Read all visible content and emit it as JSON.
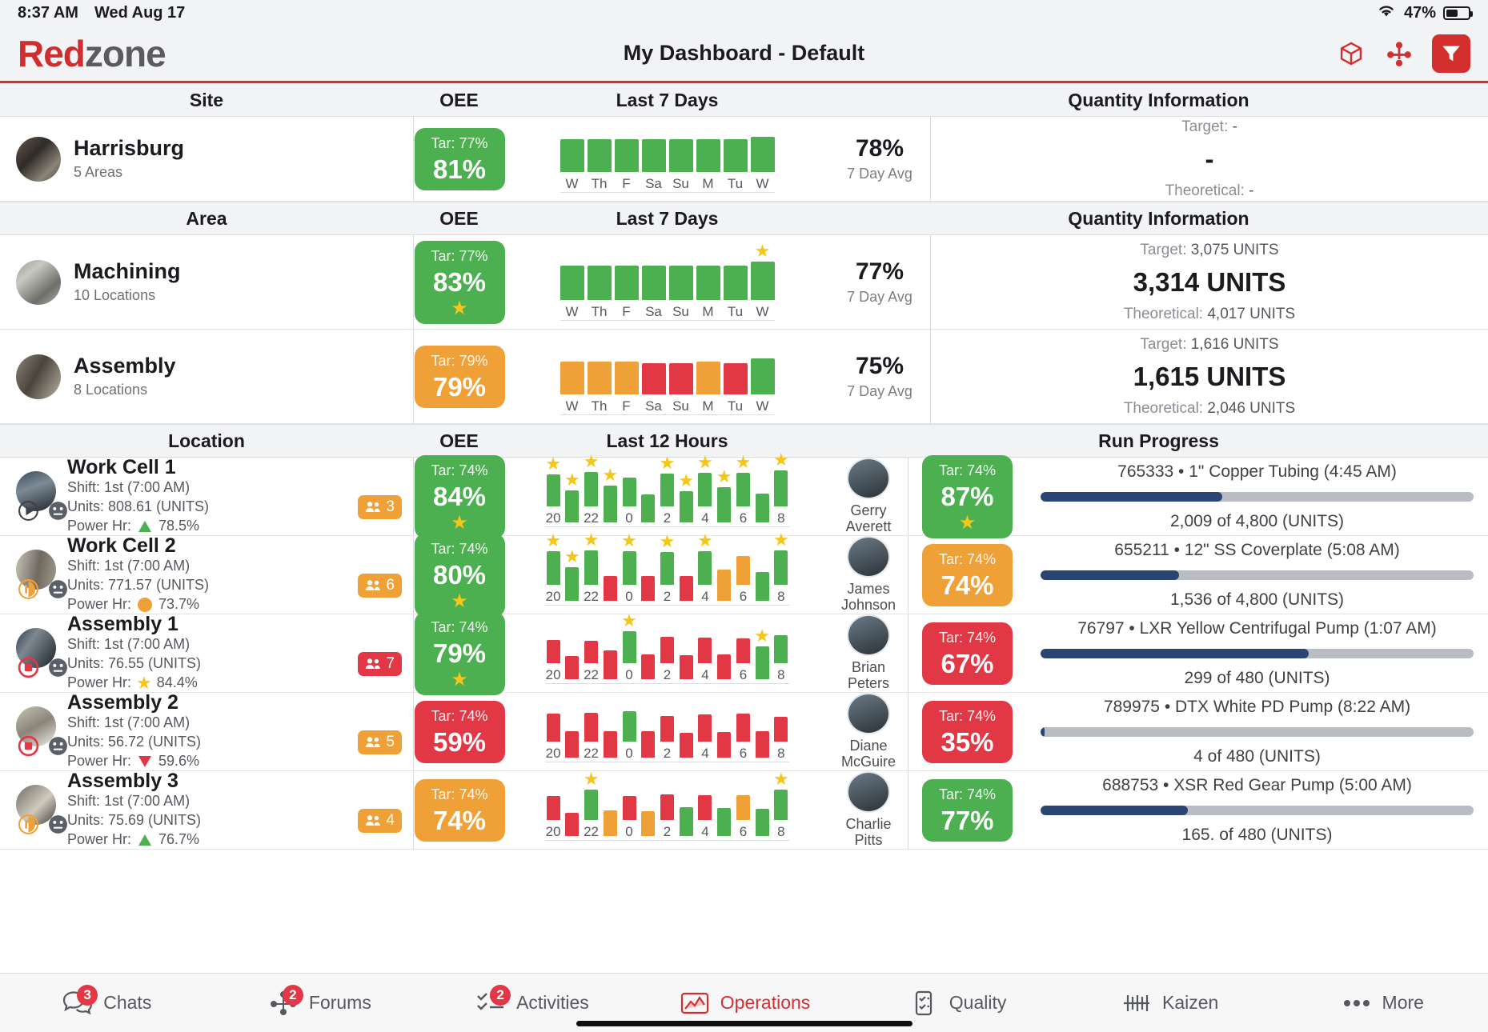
{
  "status_bar": {
    "time": "8:37 AM",
    "date": "Wed Aug 17",
    "battery_pct": "47%",
    "wifi_icon": "wifi-icon",
    "battery_icon": "battery-icon"
  },
  "header": {
    "logo_left": "Red",
    "logo_right": "zone",
    "title": "My Dashboard - Default",
    "icons": [
      {
        "name": "package-icon",
        "label": "Package"
      },
      {
        "name": "network-icon",
        "label": "Network"
      },
      {
        "name": "filter-icon",
        "label": "Filter"
      }
    ],
    "accent_color": "#d32f2f"
  },
  "sections": {
    "site": {
      "col_name": "Site",
      "col_oee": "OEE",
      "col_chart": "Last 7 Days",
      "col_qty": "Quantity Information"
    },
    "area": {
      "col_name": "Area",
      "col_oee": "OEE",
      "col_chart": "Last 7 Days",
      "col_qty": "Quantity Information"
    },
    "location": {
      "col_name": "Location",
      "col_oee": "OEE",
      "col_chart": "Last 12 Hours",
      "col_qty": "Run Progress"
    }
  },
  "labels": {
    "avg_label": "7 Day Avg",
    "target": "Target:",
    "theoretical": "Theoretical:",
    "tar_prefix": "Tar: "
  },
  "site_rows": [
    {
      "name": "Harrisburg",
      "sub": "5 Areas",
      "oee": {
        "target": "Tar: 77%",
        "value": "81%",
        "color": "g",
        "star": false
      },
      "avg": "78%",
      "qty": {
        "target": "-",
        "value": "-",
        "theoretical": "-"
      }
    }
  ],
  "area_rows": [
    {
      "name": "Machining",
      "sub": "10 Locations",
      "oee": {
        "target": "Tar: 77%",
        "value": "83%",
        "color": "g",
        "star": true
      },
      "avg": "77%",
      "qty": {
        "target": "3,075 UNITS",
        "value": "3,314 UNITS",
        "theoretical": "4,017 UNITS"
      }
    },
    {
      "name": "Assembly",
      "sub": "8 Locations",
      "oee": {
        "target": "Tar: 79%",
        "value": "79%",
        "color": "o",
        "star": false
      },
      "avg": "75%",
      "qty": {
        "target": "1,616 UNITS",
        "value": "1,615 UNITS",
        "theoretical": "2,046 UNITS"
      }
    }
  ],
  "location_rows": [
    {
      "name": "Work Cell 1",
      "shift": "Shift: 1st (7:00 AM)",
      "units": "Units: 808.61 (UNITS)",
      "power_hr": "Power Hr:",
      "power_val": "78.5%",
      "power_icon": "up-triangle-icon",
      "run_icon": "play-icon",
      "mood_icon": "neutral-face-icon",
      "people": "3",
      "people_color": "o",
      "oee": {
        "target": "Tar: 74%",
        "value": "84%",
        "color": "g",
        "star": true
      },
      "person": "Gerry\nAverett",
      "oee2": {
        "target": "Tar: 74%",
        "value": "87%",
        "color": "g",
        "star": true
      },
      "run": {
        "title": "765333 • 1\" Copper Tubing (4:45 AM)",
        "sub": "2,009 of 4,800 (UNITS)",
        "pct": 42
      }
    },
    {
      "name": "Work Cell 2",
      "shift": "Shift: 1st (7:00 AM)",
      "units": "Units: 771.57 (UNITS)",
      "power_hr": "Power Hr:",
      "power_val": "73.7%",
      "power_icon": "orange-circle-icon",
      "run_icon": "pause-play-icon",
      "mood_icon": "neutral-face-icon",
      "people": "6",
      "people_color": "o",
      "oee": {
        "target": "Tar: 74%",
        "value": "80%",
        "color": "g",
        "star": true
      },
      "person": "James\nJohnson",
      "oee2": {
        "target": "Tar: 74%",
        "value": "74%",
        "color": "o",
        "star": false
      },
      "run": {
        "title": "655211 • 12\" SS Coverplate (5:08 AM)",
        "sub": "1,536 of 4,800 (UNITS)",
        "pct": 32
      }
    },
    {
      "name": "Assembly 1",
      "shift": "Shift: 1st (7:00 AM)",
      "units": "Units: 76.55 (UNITS)",
      "power_hr": "Power Hr:",
      "power_val": "84.4%",
      "power_icon": "star-icon",
      "run_icon": "stop-icon",
      "mood_icon": "neutral-face-icon",
      "people": "7",
      "people_color": "r",
      "oee": {
        "target": "Tar: 74%",
        "value": "79%",
        "color": "g",
        "star": true
      },
      "person": "Brian\nPeters",
      "oee2": {
        "target": "Tar: 74%",
        "value": "67%",
        "color": "r",
        "star": false
      },
      "run": {
        "title": "76797 • LXR Yellow Centrifugal Pump (1:07 AM)",
        "sub": "299 of 480 (UNITS)",
        "pct": 62
      }
    },
    {
      "name": "Assembly 2",
      "shift": "Shift: 1st (7:00 AM)",
      "units": "Units: 56.72 (UNITS)",
      "power_hr": "Power Hr:",
      "power_val": "59.6%",
      "power_icon": "down-triangle-icon",
      "run_icon": "stop-icon",
      "mood_icon": "neutral-face-icon",
      "people": "5",
      "people_color": "o",
      "oee": {
        "target": "Tar: 74%",
        "value": "59%",
        "color": "r",
        "star": false
      },
      "person": "Diane\nMcGuire",
      "oee2": {
        "target": "Tar: 74%",
        "value": "35%",
        "color": "r",
        "star": false
      },
      "run": {
        "title": "789975 • DTX White PD Pump (8:22 AM)",
        "sub": "4 of 480 (UNITS)",
        "pct": 1
      }
    },
    {
      "name": "Assembly 3",
      "shift": "Shift: 1st (7:00 AM)",
      "units": "Units: 75.69 (UNITS)",
      "power_hr": "Power Hr:",
      "power_val": "76.7%",
      "power_icon": "up-triangle-icon",
      "run_icon": "pause-play-icon",
      "mood_icon": "neutral-face-icon",
      "people": "4",
      "people_color": "o",
      "oee": {
        "target": "Tar: 74%",
        "value": "74%",
        "color": "o",
        "star": false
      },
      "person": "Charlie\nPitts",
      "oee2": {
        "target": "Tar: 74%",
        "value": "77%",
        "color": "g",
        "star": false
      },
      "run": {
        "title": "688753 • XSR Red Gear Pump (5:00 AM)",
        "sub": "165. of 480 (UNITS)",
        "pct": 34
      }
    }
  ],
  "tabbar": [
    {
      "label": "Chats",
      "icon": "chat-bubbles-icon",
      "badge": "3",
      "active": false
    },
    {
      "label": "Forums",
      "icon": "forum-network-icon",
      "badge": "2",
      "active": false
    },
    {
      "label": "Activities",
      "icon": "checklist-icon",
      "badge": "2",
      "active": false
    },
    {
      "label": "Operations",
      "icon": "operations-chart-icon",
      "badge": "",
      "active": true
    },
    {
      "label": "Quality",
      "icon": "quality-clipboard-icon",
      "badge": "",
      "active": false
    },
    {
      "label": "Kaizen",
      "icon": "kaizen-icon",
      "badge": "",
      "active": false
    },
    {
      "label": "More",
      "icon": "more-dots-icon",
      "badge": "",
      "active": false
    }
  ],
  "chart_data": [
    {
      "type": "bar",
      "title": "Harrisburg Last 7 Days OEE",
      "categories": [
        "W",
        "Th",
        "F",
        "Sa",
        "Su",
        "M",
        "Tu",
        "W"
      ],
      "values": [
        78,
        78,
        78,
        78,
        78,
        78,
        78,
        84
      ],
      "colors": [
        "green",
        "green",
        "green",
        "green",
        "green",
        "green",
        "green",
        "green"
      ],
      "stars": [
        false,
        false,
        false,
        false,
        false,
        false,
        false,
        false
      ],
      "ylabel": "OEE %",
      "grid": false
    },
    {
      "type": "bar",
      "title": "Machining Last 7 Days OEE",
      "categories": [
        "W",
        "Th",
        "F",
        "Sa",
        "Su",
        "M",
        "Tu",
        "W"
      ],
      "values": [
        77,
        77,
        77,
        77,
        77,
        77,
        77,
        86
      ],
      "colors": [
        "green",
        "green",
        "green",
        "green",
        "green",
        "green",
        "green",
        "green"
      ],
      "stars": [
        false,
        false,
        false,
        false,
        false,
        false,
        false,
        true
      ],
      "ylabel": "OEE %",
      "grid": false
    },
    {
      "type": "bar",
      "title": "Assembly Last 7 Days OEE",
      "categories": [
        "W",
        "Th",
        "F",
        "Sa",
        "Su",
        "M",
        "Tu",
        "W"
      ],
      "values": [
        74,
        74,
        74,
        70,
        70,
        74,
        70,
        80
      ],
      "colors": [
        "orange",
        "orange",
        "orange",
        "red",
        "red",
        "orange",
        "red",
        "green"
      ],
      "stars": [
        false,
        false,
        false,
        false,
        false,
        false,
        false,
        false
      ],
      "ylabel": "OEE %",
      "grid": false
    },
    {
      "type": "bar",
      "title": "Work Cell 1 Last 12 Hours OEE",
      "categories": [
        "20",
        "",
        "22",
        "",
        "0",
        "",
        "2",
        "",
        "4",
        "",
        "6",
        "",
        "8"
      ],
      "x_ticks": [
        "20",
        "22",
        "0",
        "2",
        "4",
        "6",
        "8"
      ],
      "values": [
        80,
        80,
        86,
        92,
        72,
        70,
        82,
        78,
        84,
        88,
        84,
        72,
        90
      ],
      "colors": [
        "green",
        "green",
        "green",
        "green",
        "green",
        "green",
        "green",
        "green",
        "green",
        "green",
        "green",
        "green",
        "green"
      ],
      "stars": [
        true,
        true,
        true,
        true,
        false,
        false,
        true,
        true,
        true,
        true,
        true,
        false,
        true
      ],
      "ylabel": "OEE %",
      "grid": false
    },
    {
      "type": "bar",
      "title": "Work Cell 2 Last 12 Hours OEE",
      "categories": [
        "20",
        "",
        "22",
        "",
        "0",
        "",
        "2",
        "",
        "4",
        "",
        "6",
        "",
        "8"
      ],
      "x_ticks": [
        "20",
        "22",
        "0",
        "2",
        "4",
        "6",
        "8"
      ],
      "values": [
        84,
        84,
        86,
        62,
        84,
        62,
        82,
        62,
        84,
        78,
        72,
        72,
        86
      ],
      "colors": [
        "green",
        "green",
        "green",
        "red",
        "green",
        "red",
        "green",
        "red",
        "green",
        "orange",
        "orange",
        "green",
        "green"
      ],
      "stars": [
        true,
        true,
        true,
        false,
        true,
        false,
        true,
        false,
        true,
        false,
        false,
        false,
        true
      ],
      "ylabel": "OEE %",
      "grid": false
    },
    {
      "type": "bar",
      "title": "Assembly 1 Last 12 Hours OEE",
      "categories": [
        "20",
        "",
        "22",
        "",
        "0",
        "",
        "2",
        "",
        "4",
        "",
        "6",
        "",
        "8"
      ],
      "x_ticks": [
        "20",
        "22",
        "0",
        "2",
        "4",
        "6",
        "8"
      ],
      "values": [
        58,
        58,
        56,
        72,
        80,
        62,
        66,
        60,
        64,
        62,
        62,
        82,
        70
      ],
      "colors": [
        "red",
        "red",
        "red",
        "red",
        "green",
        "red",
        "red",
        "red",
        "red",
        "red",
        "red",
        "green",
        "green"
      ],
      "stars": [
        false,
        false,
        false,
        false,
        true,
        false,
        false,
        false,
        false,
        false,
        false,
        true,
        false
      ],
      "ylabel": "OEE %",
      "grid": false
    },
    {
      "type": "bar",
      "title": "Assembly 2 Last 12 Hours OEE",
      "categories": [
        "20",
        "",
        "22",
        "",
        "0",
        "",
        "2",
        "",
        "4",
        "",
        "6",
        "",
        "8"
      ],
      "x_ticks": [
        "20",
        "22",
        "0",
        "2",
        "4",
        "6",
        "8"
      ],
      "values": [
        70,
        66,
        72,
        66,
        76,
        66,
        64,
        62,
        68,
        64,
        70,
        66,
        62
      ],
      "colors": [
        "red",
        "red",
        "red",
        "red",
        "green",
        "red",
        "red",
        "red",
        "red",
        "red",
        "red",
        "red",
        "red"
      ],
      "stars": [
        false,
        false,
        false,
        false,
        false,
        false,
        false,
        false,
        false,
        false,
        false,
        false,
        false
      ],
      "ylabel": "OEE %",
      "grid": false
    },
    {
      "type": "bar",
      "title": "Assembly 3 Last 12 Hours OEE",
      "categories": [
        "20",
        "",
        "22",
        "",
        "0",
        "",
        "2",
        "",
        "4",
        "",
        "6",
        "",
        "8"
      ],
      "x_ticks": [
        "20",
        "22",
        "0",
        "2",
        "4",
        "6",
        "8"
      ],
      "values": [
        60,
        58,
        76,
        64,
        60,
        62,
        64,
        72,
        62,
        70,
        62,
        68,
        76
      ],
      "colors": [
        "red",
        "red",
        "green",
        "orange",
        "red",
        "orange",
        "red",
        "green",
        "red",
        "green",
        "orange",
        "green",
        "green"
      ],
      "stars": [
        false,
        false,
        true,
        false,
        false,
        false,
        false,
        false,
        false,
        false,
        false,
        false,
        true
      ],
      "ylabel": "OEE %",
      "grid": false
    }
  ]
}
